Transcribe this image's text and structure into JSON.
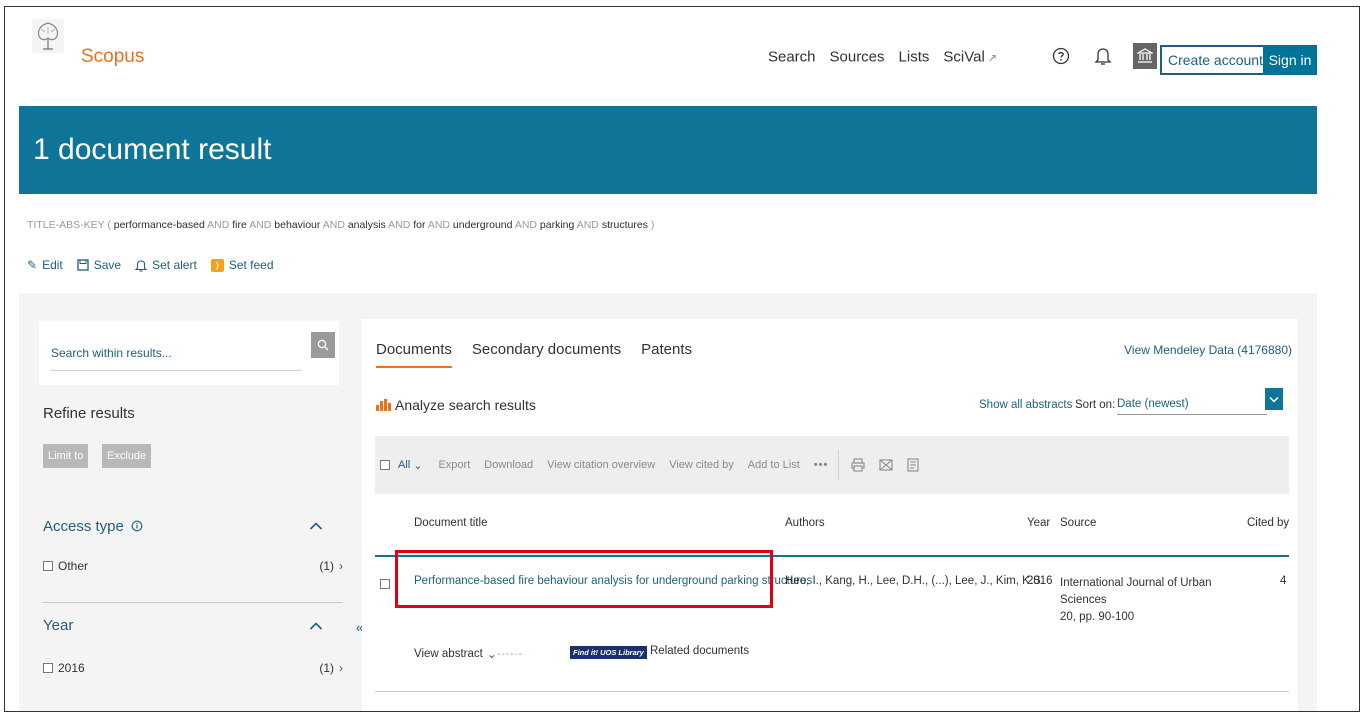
{
  "header": {
    "brand": "Scopus",
    "nav": [
      "Search",
      "Sources",
      "Lists",
      "SciVal"
    ],
    "nav_ext_icon": "external-link-icon",
    "create_account": "Create account",
    "sign_in": "Sign in",
    "icons": [
      "help-icon",
      "bell-icon",
      "institution-icon"
    ]
  },
  "banner": {
    "title": "1 document result"
  },
  "query": {
    "field": "TITLE-ABS-KEY (",
    "terms": [
      "performance-based",
      "fire",
      "behaviour",
      "analysis",
      "for",
      "underground",
      "parking",
      "structures"
    ],
    "operator": "AND",
    "close": ")"
  },
  "query_actions": [
    "Edit",
    "Save",
    "Set alert",
    "Set feed"
  ],
  "sidebar": {
    "search_placeholder": "Search within results...",
    "refine_title": "Refine results",
    "limit_to": "Limit to",
    "exclude": "Exclude",
    "facets": [
      {
        "title": "Access type",
        "items": [
          {
            "label": "Other",
            "count": "(1)"
          }
        ]
      },
      {
        "title": "Year",
        "items": [
          {
            "label": "2016",
            "count": "(1)"
          }
        ]
      }
    ]
  },
  "results": {
    "tabs": [
      "Documents",
      "Secondary documents",
      "Patents"
    ],
    "active_tab": "Documents",
    "mendeley": "View Mendeley Data (4176880)",
    "analyze": "Analyze search results",
    "show_all_abstracts": "Show all abstracts",
    "sort_label": "Sort on:",
    "sort_value": "Date (newest)",
    "toolbar": {
      "all": "All",
      "actions": [
        "Export",
        "Download",
        "View citation overview",
        "View cited by",
        "Add to List"
      ],
      "more": "•••"
    },
    "columns": [
      "Document title",
      "Authors",
      "Year",
      "Source",
      "Cited by"
    ],
    "rows": [
      {
        "title": "Performance-based fire behaviour analysis for underground parking structures",
        "authors": "Heo, I., Kang, H., Lee, D.H., (...), Lee, J., Kim, K.S.",
        "year": "2016",
        "source": "International Journal of Urban Sciences",
        "source_detail": "20, pp. 90-100",
        "cited_by": "4",
        "view_abstract": "View abstract",
        "findit": "Find it! UOS Library",
        "related": "Related documents"
      }
    ]
  },
  "colors": {
    "brand": "#e9711c",
    "banner": "#0f7598",
    "link": "#1e5f7e",
    "highlight": "#e00010"
  }
}
